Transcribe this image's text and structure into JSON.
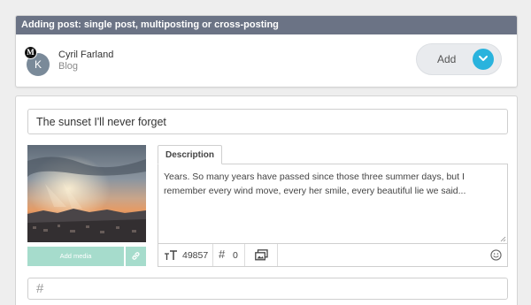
{
  "header": {
    "title": "Adding post: single post, multiposting or cross-posting"
  },
  "account": {
    "name": "Cyril Farland",
    "type": "Blog",
    "avatar_initial": "K",
    "badge_letter": "M"
  },
  "add_control": {
    "label": "Add",
    "icon": "chevron-down-icon"
  },
  "post": {
    "title_value": "The sunset I'll never forget",
    "description_tab": "Description",
    "description_text": "Years. So many years have passed since those three summer days, but I remember every wind move, every her smile, every beautiful lie we said...",
    "add_media_label": "Add media",
    "char_count": "49857",
    "hashtag_count": "0",
    "tags_placeholder": ""
  },
  "colors": {
    "header_bar": "#6b7385",
    "accent": "#2ab3dd",
    "media_button": "#a6dccc"
  }
}
